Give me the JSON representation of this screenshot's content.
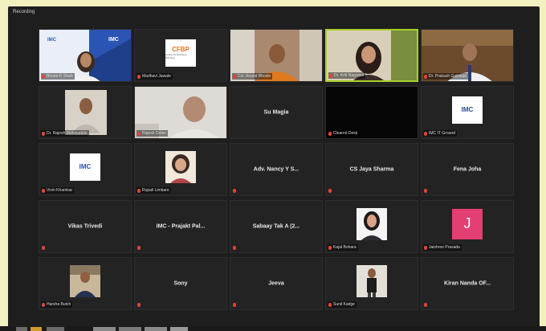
{
  "window": {
    "title": "Recording"
  },
  "participants": [
    {
      "type": "video",
      "name": "Bhumi P. Shah",
      "scene": "imc-backdrop"
    },
    {
      "type": "logo",
      "name": "Madhavi Jawale",
      "logo": "CFBP",
      "logo_sub": "Centre for Business Planning"
    },
    {
      "type": "video",
      "name": "Col. Anand Bhosle",
      "scene": "man-orange"
    },
    {
      "type": "video",
      "name": "Dr. Kriti Nagwani",
      "scene": "woman-active",
      "active": true
    },
    {
      "type": "video",
      "name": "Dr. Prakash Gaikwad",
      "scene": "man-suit"
    },
    {
      "type": "video",
      "name": "Dr. Rajesh Mohinuddin",
      "scene": "man-room"
    },
    {
      "type": "video",
      "name": "Rajesh Dolen",
      "scene": "bald-man"
    },
    {
      "type": "text",
      "name": "Su Magia",
      "label": "Su Magia",
      "muted": false
    },
    {
      "type": "black",
      "name": "Cleared Desk"
    },
    {
      "type": "logo",
      "name": "IMC IT Ground",
      "logo": "IMC"
    },
    {
      "type": "logo",
      "name": "Vivin Khamkar",
      "logo": "IMC"
    },
    {
      "type": "photo",
      "name": "Rupali Limbare",
      "scene": "woman-portrait"
    },
    {
      "type": "text",
      "name": "",
      "label": "Adv. Nancy Y S..."
    },
    {
      "type": "text",
      "name": "",
      "label": "CS Jaya Sharma"
    },
    {
      "type": "text",
      "name": "",
      "label": "Fena Joha"
    },
    {
      "type": "text",
      "name": "",
      "label": "Vikas Trivedi"
    },
    {
      "type": "text",
      "name": "",
      "label": "IMC - Prajakt Pal..."
    },
    {
      "type": "text",
      "name": "",
      "label": "Sabaay Tak A (2..."
    },
    {
      "type": "photo",
      "name": "Kajal Bohara",
      "scene": "woman-small"
    },
    {
      "type": "avatar",
      "name": "Jaishree Prasada",
      "letter": "J",
      "color": "#e43f73"
    },
    {
      "type": "photo",
      "name": "Harsha Butch",
      "scene": "man-small"
    },
    {
      "type": "text",
      "name": "",
      "label": "Sony"
    },
    {
      "type": "text",
      "name": "",
      "label": "Jeeva"
    },
    {
      "type": "photo",
      "name": "Sunil Kadge",
      "scene": "man-standing"
    },
    {
      "type": "text",
      "name": "",
      "label": "Kiran Nanda OF..."
    }
  ],
  "colors": {
    "active_border": "#a9cf2a",
    "muted_mic": "#e0453a",
    "tile_bg": "#232323"
  }
}
